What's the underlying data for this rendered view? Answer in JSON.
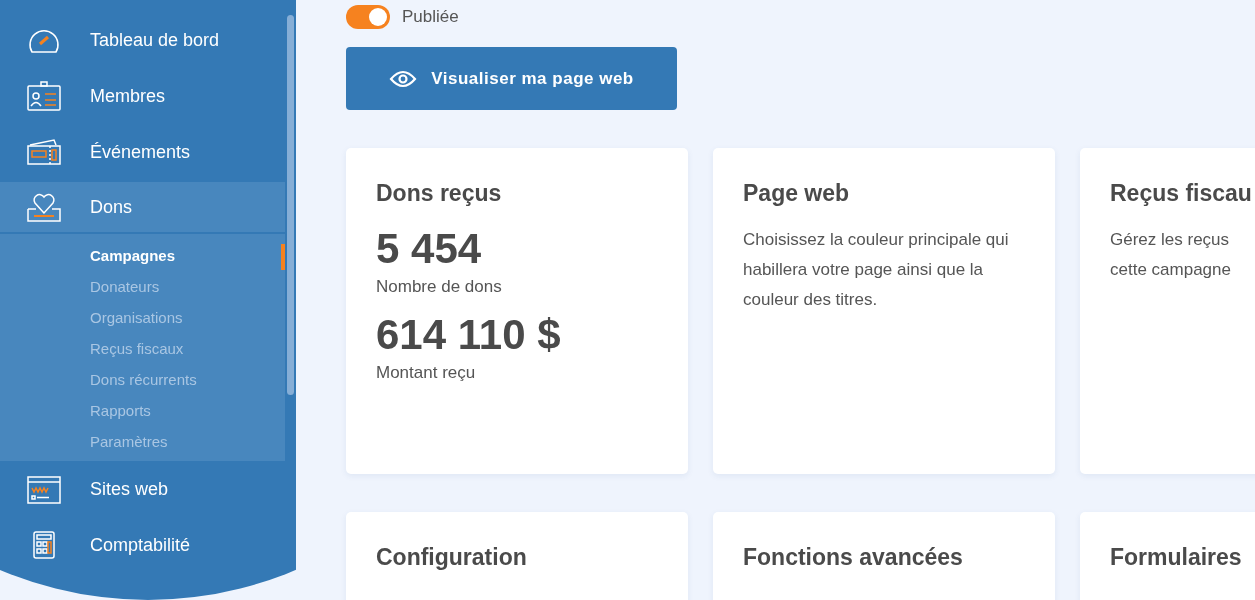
{
  "sidebar": {
    "items": [
      {
        "label": "Tableau de bord",
        "selected": false
      },
      {
        "label": "Membres",
        "selected": false
      },
      {
        "label": "Événements",
        "selected": false
      },
      {
        "label": "Dons",
        "selected": true,
        "expanded": true,
        "children": [
          {
            "label": "Campagnes",
            "selected": true
          },
          {
            "label": "Donateurs",
            "selected": false
          },
          {
            "label": "Organisations",
            "selected": false
          },
          {
            "label": "Reçus fiscaux",
            "selected": false
          },
          {
            "label": "Dons récurrents",
            "selected": false
          },
          {
            "label": "Rapports",
            "selected": false
          },
          {
            "label": "Paramètres",
            "selected": false
          }
        ]
      },
      {
        "label": "Sites web",
        "selected": false
      },
      {
        "label": "Comptabilité",
        "selected": false
      }
    ]
  },
  "publish_toggle": {
    "label": "Publiée",
    "on": true
  },
  "preview_button": {
    "label": "Visualiser ma page web"
  },
  "cards": [
    {
      "kind": "stats",
      "title": "Dons reçus",
      "stats": [
        {
          "value": "5 454",
          "label": "Nombre de dons"
        },
        {
          "value": "614 110 $",
          "label": "Montant reçu"
        }
      ]
    },
    {
      "kind": "text",
      "title": "Page web",
      "lines": [
        "Choisissez la couleur principale qui habillera votre page ainsi que la couleur des titres."
      ]
    },
    {
      "kind": "text",
      "title": "Reçus fiscau",
      "lines": [
        "Gérez les reçus",
        "cette campagne"
      ]
    },
    {
      "kind": "text",
      "title": "Configuration"
    },
    {
      "kind": "text",
      "title": "Fonctions avancées"
    },
    {
      "kind": "text",
      "title": "Formulaires"
    }
  ]
}
